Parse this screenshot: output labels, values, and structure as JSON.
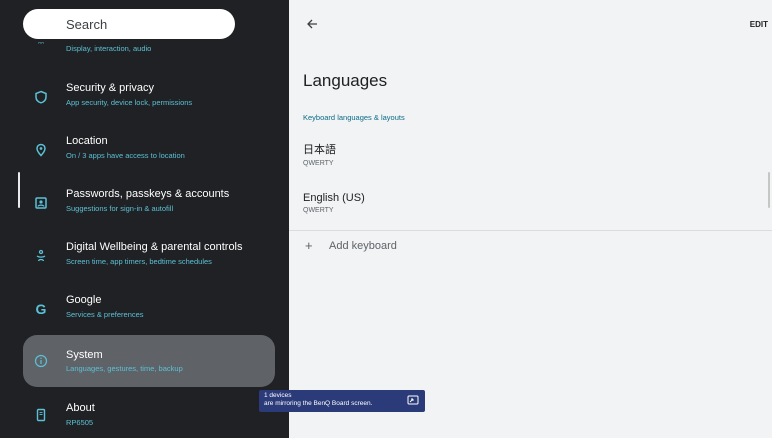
{
  "search": {
    "placeholder": "Search"
  },
  "sidebar": {
    "partial_item": {
      "subtitle": "Display, interaction, audio"
    },
    "items": [
      {
        "title": "Security & privacy",
        "subtitle": "App security, device lock, permissions",
        "icon": "shield-icon"
      },
      {
        "title": "Location",
        "subtitle": "On / 3 apps have access to location",
        "icon": "location-pin-icon"
      },
      {
        "title": "Passwords, passkeys & accounts",
        "subtitle": "Suggestions for sign-in & autofill",
        "icon": "account-box-icon"
      },
      {
        "title": "Digital Wellbeing & parental controls",
        "subtitle": "Screen time, app timers, bedtime schedules",
        "icon": "wellbeing-icon"
      },
      {
        "title": "Google",
        "subtitle": "Services & preferences",
        "icon": "google-icon"
      },
      {
        "title": "System",
        "subtitle": "Languages, gestures, time, backup",
        "icon": "info-icon",
        "selected": true
      },
      {
        "title": "About",
        "subtitle": "RP6505",
        "icon": "phone-icon"
      }
    ]
  },
  "main": {
    "edit_label": "EDIT",
    "title": "Languages",
    "section_header": "Keyboard languages & layouts",
    "languages": [
      {
        "name": "日本語",
        "layout": "QWERTY"
      },
      {
        "name": "English (US)",
        "layout": "QWERTY"
      }
    ],
    "add_keyboard_label": "Add keyboard"
  },
  "toast": {
    "line1": "1 devices",
    "line2": "are mirroring the BenQ Board screen."
  },
  "colors": {
    "sidebar_bg": "#202124",
    "accent": "#5bc1d6",
    "selected_bg": "#5f6368",
    "main_bg": "#f1f3f4",
    "toast_bg": "#2b3b7a"
  }
}
